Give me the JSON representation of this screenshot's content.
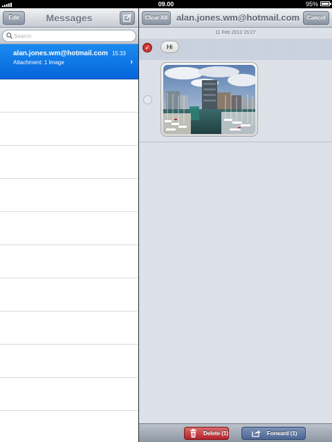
{
  "status": {
    "time": "09.00",
    "battery": "95%"
  },
  "sidebar": {
    "edit_label": "Edit",
    "title": "Messages",
    "compose_icon": "compose-icon",
    "search": {
      "placeholder": "Search",
      "value": ""
    },
    "conversation": {
      "name": "alan.jones.wm@hotmail.com",
      "time": "15:33",
      "preview": "Attachment: 1 Image"
    }
  },
  "detail": {
    "clear_all_label": "Clear All",
    "title": "alan.jones.wm@hotmail.com",
    "cancel_label": "Cancel",
    "timestamp": "11 Feb 2013 15:27",
    "messages": [
      {
        "type": "text",
        "text": "Hi",
        "selected": true
      },
      {
        "type": "image",
        "selected": false
      }
    ]
  },
  "toolbar": {
    "delete_label": "Delete (1)",
    "forward_label": "Forward (1)"
  },
  "colors": {
    "accent": "#0a6ee4",
    "delete": "#b3222a",
    "forward": "#4b6592"
  }
}
